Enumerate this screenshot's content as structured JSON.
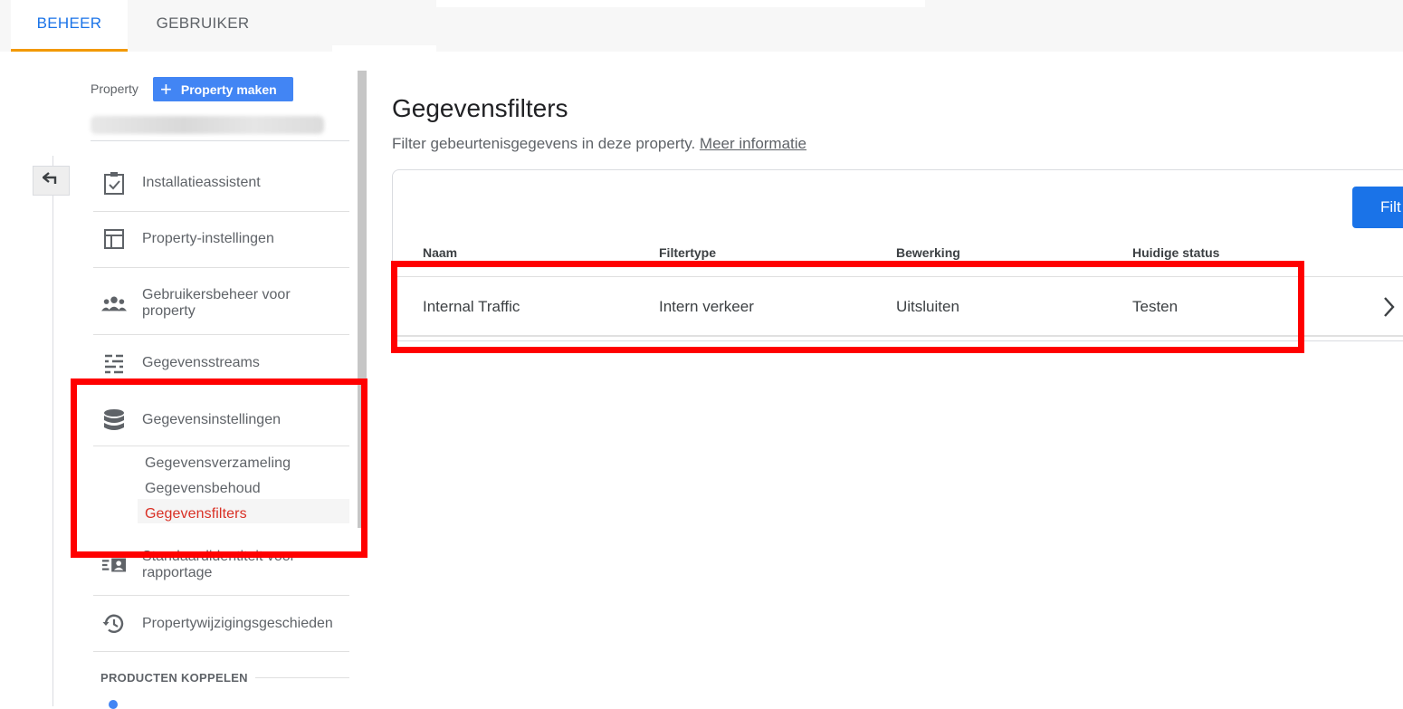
{
  "tabs": [
    {
      "label": "BEHEER",
      "active": true
    },
    {
      "label": "GEBRUIKER",
      "active": false
    }
  ],
  "property": {
    "label": "Property",
    "create_button": "Property maken"
  },
  "nav": {
    "items": [
      {
        "label": "Installatieassistent",
        "icon": "clipboard-check-icon"
      },
      {
        "label": "Property-instellingen",
        "icon": "layout-icon"
      },
      {
        "label": "Gebruikersbeheer voor property",
        "icon": "people-icon"
      },
      {
        "label": "Gegevensstreams",
        "icon": "streams-icon"
      },
      {
        "label": "Gegevensinstellingen",
        "icon": "database-icon"
      },
      {
        "label": "Standaardidentiteit voor rapportage",
        "icon": "identity-icon"
      },
      {
        "label": "Propertywijzigingsgeschieden",
        "icon": "history-icon"
      }
    ],
    "subitems": [
      {
        "label": "Gegevensverzameling",
        "active": false
      },
      {
        "label": "Gegevensbehoud",
        "active": false
      },
      {
        "label": "Gegevensfilters",
        "active": true
      }
    ],
    "section_label": "PRODUCTEN KOPPELEN"
  },
  "main": {
    "title": "Gegevensfilters",
    "subtitle": "Filter gebeurtenisgegevens in deze property.",
    "link": "Meer informatie",
    "action_button": "Filt",
    "columns": [
      "Naam",
      "Filtertype",
      "Bewerking",
      "Huidige status"
    ],
    "rows": [
      [
        "Internal Traffic",
        "Intern verkeer",
        "Uitsluiten",
        "Testen"
      ]
    ]
  },
  "colors": {
    "accent": "#1a73e8",
    "tab_underline": "#f29900",
    "active_subitem": "#d93025",
    "highlight": "#ff0000"
  }
}
